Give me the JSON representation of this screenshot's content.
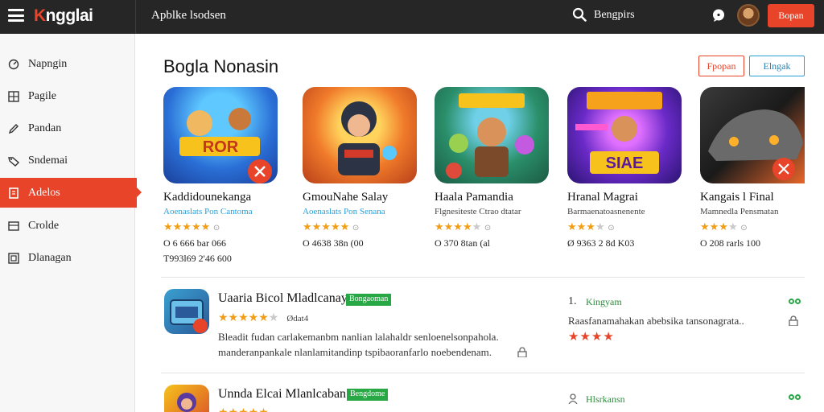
{
  "topbar": {
    "logo_prefix": "K",
    "logo_rest": "ngglai",
    "app_title": "Apblke lsodsen",
    "search_label": "Bengpirs",
    "button_label": "Bopan"
  },
  "sidebar": {
    "items": [
      {
        "label": "Napngin",
        "icon": "gauge-icon"
      },
      {
        "label": "Pagile",
        "icon": "grid-icon"
      },
      {
        "label": "Pandan",
        "icon": "pen-icon"
      },
      {
        "label": "Sndemai",
        "icon": "tag-icon"
      },
      {
        "label": "Adelos",
        "icon": "document-icon",
        "active": true
      },
      {
        "label": "Crolde",
        "icon": "box-icon"
      },
      {
        "label": "Dlanagan",
        "icon": "frame-icon"
      }
    ]
  },
  "section": {
    "title": "Boglа Nonasin",
    "btn_red": "Fpopan",
    "btn_blue": "Elngak"
  },
  "cards": [
    {
      "name": "Kaddidounekanga",
      "publisher": "Aoenaslats Pon Cantoma",
      "publisher_color": "#2a9fd6",
      "stars_on": 5,
      "stars_text": "★★★★★",
      "stats": "O 6 666 bar 066",
      "stats2": "T993l69 2'46 600"
    },
    {
      "name": "GmouNahe Salay",
      "publisher": "Aoenaslats Pon Senana",
      "publisher_color": "#2a9fd6",
      "stars_on": 5,
      "stars_text": "★★★★★",
      "stats": "O 4638 38n (00",
      "stats2": ""
    },
    {
      "name": "Haala Pamandia",
      "publisher": "Flgnesiteste Ctrao dtatar",
      "publisher_color": "#444444",
      "stars_on": 4,
      "stars_text": "★★★★",
      "stats": "O 370 8tan (al",
      "stats2": ""
    },
    {
      "name": "Hranal Magrai",
      "publisher": "Barmaenatoasnenente",
      "publisher_color": "#444444",
      "stars_on": 3,
      "stars_text": "★★★",
      "stats": "Ø 9363 2 8d K03",
      "stats2": ""
    },
    {
      "name": "Kangais l Final",
      "publisher": "Mamnedla Pensmatan",
      "publisher_color": "#444444",
      "stars_on": 3,
      "stars_text": "★★★",
      "stats": "O 208 rarls 100",
      "stats2": ""
    }
  ],
  "rows": [
    {
      "title": "Uaaria Bicol Mladlcanay",
      "badge": "Bongaoman",
      "stars": "★★★★★",
      "star_note": "Ødat4",
      "desc1": "Bleadit fudan carlakemanbm nanlian lalahaldr senloenelsonpahola.",
      "desc2": "manderanpankale nlanlamitandinp tspibaoranfarlo noebendenam.",
      "side_num": "1.",
      "side_label": "Kingyam",
      "side_desc": "Raasfanamahakan abebsika tansonagrata..",
      "side_stars": "★★★★"
    },
    {
      "title": "Unnda Elcai Mlanlcaban",
      "badge": "Bengdome",
      "stars": "★★★★★",
      "star_note": "",
      "desc1": "",
      "desc2": "",
      "side_num": "",
      "side_label": "Hlsrkansn",
      "side_desc": "",
      "side_stars": ""
    }
  ],
  "colors": {
    "accent": "#e8442a",
    "topbar": "#262626",
    "badge": "#28a745",
    "link": "#2a9fd6"
  }
}
